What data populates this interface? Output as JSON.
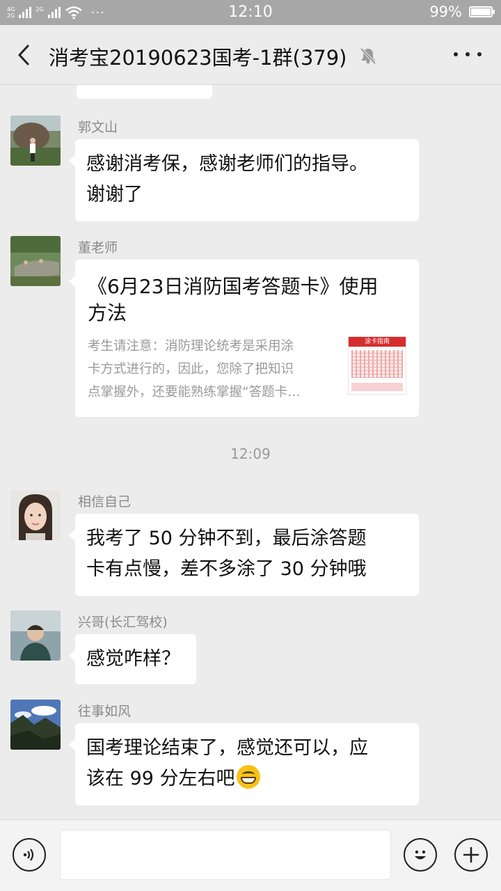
{
  "status_bar": {
    "network_top": "4G",
    "network_bottom": "2G",
    "network_mid": "2G",
    "overflow": "···",
    "time": "12:10",
    "battery_percent": "99%"
  },
  "header": {
    "title": "消考宝20190623国考-1群(379)",
    "back_icon": "back-chevron-icon",
    "mute_icon": "bell-muted-icon",
    "more_icon": "more-dots-icon"
  },
  "messages": [
    {
      "sender": "郭文山",
      "lines": [
        "感谢消考保，感谢老师们的指导。",
        "谢谢了"
      ]
    },
    {
      "sender": "董老师",
      "type": "link",
      "title_lines": [
        "《6月23日消防国考答题卡》使用",
        "方法"
      ],
      "desc_lines": [
        "考生请注意：消防理论统考是采用涂",
        "卡方式进行的，因此，您除了把知识",
        "点掌握外，还要能熟练掌握“答题卡…"
      ],
      "thumb_label": "涂卡指南"
    },
    {
      "type": "time",
      "time": "12:09"
    },
    {
      "sender": "相信自己",
      "lines": [
        "我考了 50 分钟不到，最后涂答题",
        "卡有点慢，差不多涂了 30 分钟哦"
      ]
    },
    {
      "sender": "兴哥(长汇驾校)",
      "lines": [
        "感觉咋样？"
      ]
    },
    {
      "sender": "往事如风",
      "lines": [
        "国考理论结束了，感觉还可以，应",
        "该在 99 分左右吧"
      ],
      "emoji": "grinning-face-icon"
    }
  ],
  "input_bar": {
    "voice_icon": "voice-icon",
    "emoji_icon": "emoji-icon",
    "plus_icon": "plus-icon",
    "text_value": ""
  },
  "colors": {
    "status_bar_bg": "#a7a7a7",
    "chat_bg": "#ececec",
    "bubble_bg": "#ffffff",
    "secondary_text": "#8a8a8a"
  }
}
